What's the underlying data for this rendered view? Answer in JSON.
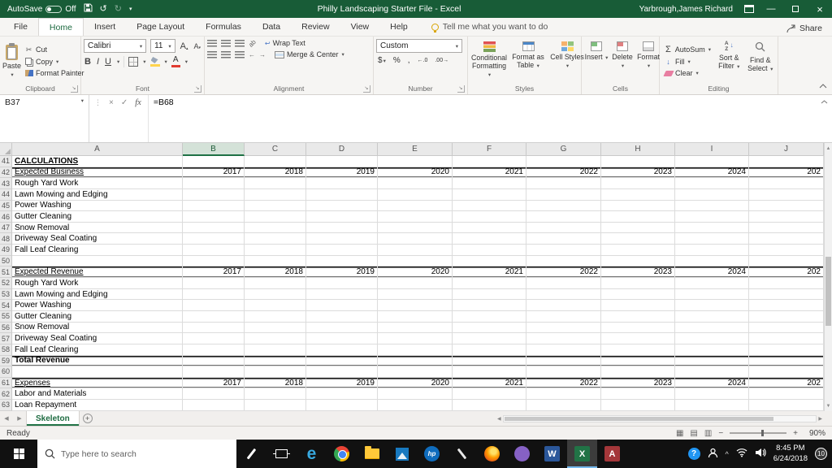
{
  "titlebar": {
    "autosave_label": "AutoSave",
    "autosave_state": "Off",
    "title": "Philly Landscaping Starter File - Excel",
    "user": "Yarbrough,James Richard"
  },
  "menu": {
    "tabs": [
      "File",
      "Home",
      "Insert",
      "Page Layout",
      "Formulas",
      "Data",
      "Review",
      "View",
      "Help"
    ],
    "active_tab": "Home",
    "tell_me": "Tell me what you want to do",
    "share": "Share"
  },
  "ribbon": {
    "clipboard": {
      "label": "Clipboard",
      "paste": "Paste",
      "cut": "Cut",
      "copy": "Copy",
      "format_painter": "Format Painter"
    },
    "font": {
      "label": "Font",
      "family": "Calibri",
      "size": "11",
      "bold": "B",
      "italic": "I",
      "underline": "U"
    },
    "alignment": {
      "label": "Alignment",
      "wrap_text": "Wrap Text",
      "merge_center": "Merge & Center"
    },
    "number": {
      "label": "Number",
      "format": "Custom",
      "currency": "$",
      "percent": "%",
      "comma": ",",
      "increase_decimal": "←.0",
      "decrease_decimal": ".00→"
    },
    "styles": {
      "label": "Styles",
      "conditional_formatting": "Conditional Formatting",
      "format_as_table": "Format as Table",
      "cell_styles": "Cell Styles"
    },
    "cells": {
      "label": "Cells",
      "insert": "Insert",
      "delete": "Delete",
      "format": "Format"
    },
    "editing": {
      "label": "Editing",
      "autosum": "AutoSum",
      "fill": "Fill",
      "clear": "Clear",
      "sort_filter": "Sort & Filter",
      "find_select": "Find & Select"
    }
  },
  "formula_bar": {
    "name_box": "B37",
    "formula": "=B68"
  },
  "grid": {
    "columns": [
      "A",
      "B",
      "C",
      "D",
      "E",
      "F",
      "G",
      "H",
      "I",
      "J"
    ],
    "active_column": "B",
    "years": [
      "2017",
      "2018",
      "2019",
      "2020",
      "2021",
      "2022",
      "2023",
      "2024",
      "202"
    ],
    "rows": [
      {
        "n": "41",
        "a": "CALCULATIONS",
        "f": "bold underline"
      },
      {
        "n": "42",
        "a": "Expected Business",
        "f": "underline hline",
        "y": 1
      },
      {
        "n": "43",
        "a": "Rough Yard Work",
        "f": ""
      },
      {
        "n": "44",
        "a": "Lawn Mowing and Edging",
        "f": ""
      },
      {
        "n": "45",
        "a": "Power Washing",
        "f": ""
      },
      {
        "n": "46",
        "a": "Gutter Cleaning",
        "f": ""
      },
      {
        "n": "47",
        "a": "Snow Removal",
        "f": ""
      },
      {
        "n": "48",
        "a": "Driveway Seal Coating",
        "f": ""
      },
      {
        "n": "49",
        "a": "Fall Leaf Clearing",
        "f": ""
      },
      {
        "n": "50",
        "a": "",
        "f": ""
      },
      {
        "n": "51",
        "a": "Expected Revenue",
        "f": "underline hline",
        "y": 1
      },
      {
        "n": "52",
        "a": "Rough Yard Work",
        "f": ""
      },
      {
        "n": "53",
        "a": "Lawn Mowing and Edging",
        "f": ""
      },
      {
        "n": "54",
        "a": "Power Washing",
        "f": ""
      },
      {
        "n": "55",
        "a": "Gutter Cleaning",
        "f": ""
      },
      {
        "n": "56",
        "a": "Snow Removal",
        "f": ""
      },
      {
        "n": "57",
        "a": "Driveway Seal Coating",
        "f": ""
      },
      {
        "n": "58",
        "a": "Fall Leaf Clearing",
        "f": ""
      },
      {
        "n": "59",
        "a": "Total Revenue",
        "f": "bold hline"
      },
      {
        "n": "60",
        "a": "",
        "f": ""
      },
      {
        "n": "61",
        "a": "Expenses",
        "f": "underline hline",
        "y": 1
      },
      {
        "n": "62",
        "a": "Labor and Materials",
        "f": ""
      },
      {
        "n": "63",
        "a": "Loan Repayment",
        "f": ""
      }
    ]
  },
  "sheetbar": {
    "tab": "Skeleton"
  },
  "status": {
    "mode": "Ready",
    "zoom": "90%"
  },
  "taskbar": {
    "search_placeholder": "Type here to search",
    "icons": [
      "pen",
      "task-view",
      "edge",
      "chrome",
      "explorer",
      "photos",
      "hp",
      "sketch",
      "firefox",
      "media",
      "word",
      "excel",
      "access"
    ],
    "active_icon": "excel",
    "time": "8:45 PM",
    "date": "6/24/2018",
    "notification_count": "10"
  },
  "colors": {
    "title_green": "#185c37",
    "excel_green": "#217346",
    "word_blue": "#2b579a",
    "access_red": "#a4373a",
    "taskbar_black": "#111111"
  },
  "icons": {
    "dropdown": "▾",
    "launcher": "↘",
    "sigma": "Σ",
    "scissors": "✂",
    "undo": "↺",
    "redo": "↻",
    "minimize": "—",
    "close": "×",
    "check": "✓",
    "fx": "fx",
    "ellipsis": "⋮",
    "left": "◀",
    "right": "▶",
    "up": "▲",
    "down": "▼",
    "plus": "+",
    "minus": "−",
    "caret": "^",
    "view_normal": "▦",
    "view_layout": "▤",
    "view_break": "▥",
    "wrap_arrow": "↩",
    "indent_left": "←",
    "indent_right": "→",
    "fill_down": "↓"
  }
}
